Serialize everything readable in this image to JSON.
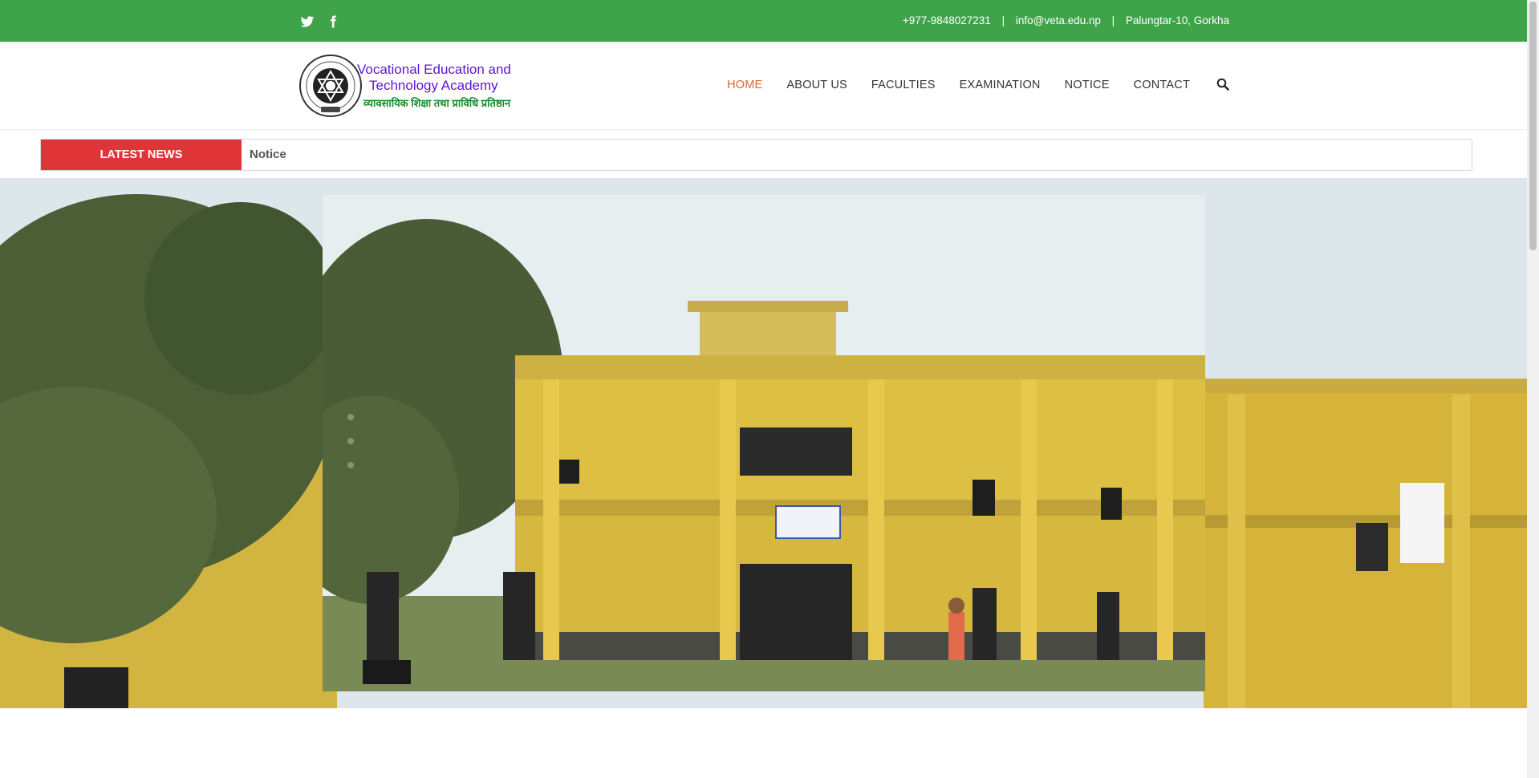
{
  "topbar": {
    "social": [
      {
        "icon": "twitter-icon"
      },
      {
        "icon": "facebook-icon"
      }
    ],
    "phone": "+977-9848027231",
    "email": "info@veta.edu.np",
    "address": "Palungtar-10, Gorkha",
    "separator": "|"
  },
  "logo": {
    "line1": "Vocational Education and",
    "line2": "Technology Academy",
    "line3": "व्यावसायिक शिक्षा तथा प्राविधि प्रतिष्ठान",
    "seal_text_top": "Vocational Education Technology Academy",
    "seal_inner": "VETA",
    "seal_year": "2075"
  },
  "nav": {
    "items": [
      {
        "label": "HOME",
        "active": true
      },
      {
        "label": "ABOUT US"
      },
      {
        "label": "FACULTIES"
      },
      {
        "label": "EXAMINATION"
      },
      {
        "label": "NOTICE"
      },
      {
        "label": "CONTACT"
      }
    ],
    "search_icon": "search-icon"
  },
  "ticker": {
    "label": "LATEST NEWS",
    "text": "Notice"
  },
  "slider": {
    "dots": 3,
    "active_dot": 0
  },
  "colors": {
    "topbar": "#3fa34a",
    "active_nav": "#d5682e",
    "ticker_label": "#df3538",
    "logo_blue": "#5a16d9",
    "logo_green": "#1a8a2b"
  }
}
